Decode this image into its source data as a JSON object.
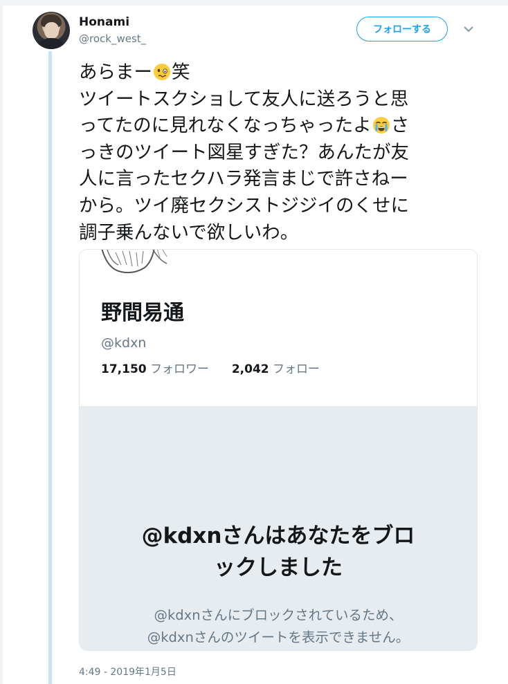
{
  "tweet": {
    "author": {
      "display_name": "Honami",
      "username": "@rock_west_",
      "avatar_icon": "avatar-photo"
    },
    "follow_button_label": "フォローする",
    "menu_icon": "chevron-down-icon",
    "text_lines": [
      "あらまー",
      "ツイートスクショして友人に送ろうと思",
      "ってたのに見れなくなっちゃったよ",
      "っきのツイート図星すぎた？あんたが友",
      "人に言ったセクハラ発言まじで許さねー",
      "から。ツイ廃セクシストジジイのくせに",
      "調子乗んないで欲しいわ。"
    ],
    "text_fragments": {
      "line1_suffix": "笑",
      "line3_suffix": "さ"
    },
    "emojis": [
      "woozy-face-emoji",
      "crying-face-emoji"
    ],
    "timestamp": "4:49 - 2019年1月5日"
  },
  "embedded_card": {
    "profile_name": "野間易通",
    "profile_handle": "@kdxn",
    "followers_count": "17,150",
    "followers_label": "フォロワー",
    "following_count": "2,042",
    "following_label": "フォロー",
    "blocked_title_line1": "@kdxnさんはあなたをブロ",
    "blocked_title_line2": "ックしました",
    "blocked_desc_line1": "@kdxnさんにブロックされているため、",
    "blocked_desc_line2": "@kdxnさんのツイートを表示できません。"
  },
  "colors": {
    "accent": "#1da1f2",
    "thread_line": "#c4e4f8",
    "secondary_text": "#657786",
    "card_gray": "#e6ecf0"
  }
}
